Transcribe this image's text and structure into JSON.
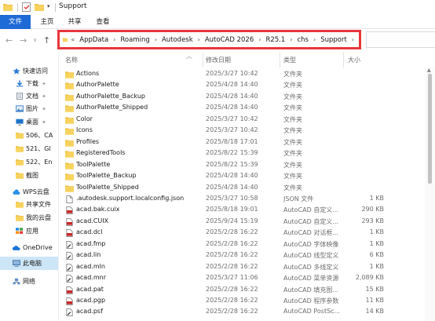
{
  "window": {
    "title": "Support"
  },
  "ribbon": {
    "tabs": [
      "文件",
      "主页",
      "共享",
      "查看"
    ]
  },
  "nav": {
    "back_icon": "arrow-left-icon",
    "forward_icon": "arrow-right-icon",
    "recent_icon": "chevron-down-icon",
    "up_icon": "arrow-up-icon"
  },
  "address": {
    "overflow": "«",
    "crumbs": [
      "AppData",
      "Roaming",
      "Autodesk",
      "AutoCAD 2026",
      "R25.1",
      "chs",
      "Support"
    ],
    "highlight_color": "#e8363b"
  },
  "sidebar": {
    "items": [
      {
        "label": "快速访问",
        "icon": "star-icon",
        "pinned": false
      },
      {
        "label": "下载",
        "icon": "download-icon",
        "pinned": true
      },
      {
        "label": "文档",
        "icon": "document-icon",
        "pinned": true
      },
      {
        "label": "图片",
        "icon": "picture-icon",
        "pinned": true
      },
      {
        "label": "桌面",
        "icon": "desktop-icon",
        "pinned": true
      },
      {
        "label": "506、CA",
        "icon": "folder-icon",
        "pinned": false
      },
      {
        "label": "521、Gl",
        "icon": "folder-icon",
        "pinned": false
      },
      {
        "label": "522、En",
        "icon": "folder-icon",
        "pinned": false
      },
      {
        "label": "截图",
        "icon": "folder-icon",
        "pinned": false
      },
      {
        "label": "WPS云盘",
        "icon": "cloud-icon",
        "pinned": false
      },
      {
        "label": "共享文件",
        "icon": "folder-icon",
        "pinned": false
      },
      {
        "label": "我的云盘",
        "icon": "folder-icon",
        "pinned": false
      },
      {
        "label": "应用",
        "icon": "apps-icon",
        "pinned": false
      },
      {
        "label": "OneDrive",
        "icon": "onedrive-icon",
        "pinned": false
      },
      {
        "label": "此电脑",
        "icon": "computer-icon",
        "pinned": false
      },
      {
        "label": "网络",
        "icon": "network-icon",
        "pinned": false
      }
    ]
  },
  "columns": {
    "name": "名称",
    "date": "修改日期",
    "type": "类型",
    "size": "大小"
  },
  "files": [
    {
      "name": "Actions",
      "date": "2025/3/27 10:42",
      "type": "文件夹",
      "size": "",
      "icon": "folder-icon"
    },
    {
      "name": "AuthorPalette",
      "date": "2025/4/28 14:40",
      "type": "文件夹",
      "size": "",
      "icon": "folder-icon"
    },
    {
      "name": "AuthorPalette_Backup",
      "date": "2025/4/28 14:40",
      "type": "文件夹",
      "size": "",
      "icon": "folder-icon"
    },
    {
      "name": "AuthorPalette_Shipped",
      "date": "2025/4/28 14:40",
      "type": "文件夹",
      "size": "",
      "icon": "folder-icon"
    },
    {
      "name": "Color",
      "date": "2025/3/27 10:42",
      "type": "文件夹",
      "size": "",
      "icon": "folder-icon"
    },
    {
      "name": "Icons",
      "date": "2025/3/27 10:42",
      "type": "文件夹",
      "size": "",
      "icon": "folder-icon"
    },
    {
      "name": "Profiles",
      "date": "2025/8/18 17:01",
      "type": "文件夹",
      "size": "",
      "icon": "folder-icon"
    },
    {
      "name": "RegisteredTools",
      "date": "2025/8/22 15:39",
      "type": "文件夹",
      "size": "",
      "icon": "folder-icon"
    },
    {
      "name": "ToolPalette",
      "date": "2025/8/22 15:39",
      "type": "文件夹",
      "size": "",
      "icon": "folder-icon"
    },
    {
      "name": "ToolPalette_Backup",
      "date": "2025/4/28 14:40",
      "type": "文件夹",
      "size": "",
      "icon": "folder-icon"
    },
    {
      "name": "ToolPalette_Shipped",
      "date": "2025/4/28 14:40",
      "type": "文件夹",
      "size": "",
      "icon": "folder-icon"
    },
    {
      "name": ".autodesk.support.localconfig.json",
      "date": "2025/3/27 10:58",
      "type": "JSON 文件",
      "size": "1 KB",
      "icon": "file-icon"
    },
    {
      "name": "acad.bak.cuix",
      "date": "2025/8/18 19:01",
      "type": "AutoCAD 自定义...",
      "size": "290 KB",
      "icon": "cad-file-icon"
    },
    {
      "name": "acad.CUIX",
      "date": "2025/9/24 15:19",
      "type": "AutoCAD 自定义...",
      "size": "293 KB",
      "icon": "cad-file-icon"
    },
    {
      "name": "acad.dcl",
      "date": "2025/2/28 16:22",
      "type": "AutoCAD 对话框...",
      "size": "1 KB",
      "icon": "cad-file-icon"
    },
    {
      "name": "acad.fmp",
      "date": "2025/2/28 16:22",
      "type": "AutoCAD 字体映像",
      "size": "1 KB",
      "icon": "edit-file-icon"
    },
    {
      "name": "acad.lin",
      "date": "2025/2/28 16:22",
      "type": "AutoCAD 线型定义",
      "size": "6 KB",
      "icon": "edit-file-icon"
    },
    {
      "name": "acad.mln",
      "date": "2025/2/28 16:22",
      "type": "AutoCAD 多线定义",
      "size": "1 KB",
      "icon": "edit-file-icon"
    },
    {
      "name": "acad.mnr",
      "date": "2025/3/27 11:06",
      "type": "AutoCAD 菜单资源",
      "size": "2,089 KB",
      "icon": "edit-file-icon"
    },
    {
      "name": "acad.pat",
      "date": "2025/2/28 16:22",
      "type": "AutoCAD 填充图...",
      "size": "15 KB",
      "icon": "cad-file-icon"
    },
    {
      "name": "acad.pgp",
      "date": "2025/2/28 16:22",
      "type": "AutoCAD 程序参数",
      "size": "11 KB",
      "icon": "cad-file-icon"
    },
    {
      "name": "acad.psf",
      "date": "2025/2/28 16:22",
      "type": "AutoCAD PostSc...",
      "size": "14 KB",
      "icon": "edit-file-icon"
    }
  ]
}
